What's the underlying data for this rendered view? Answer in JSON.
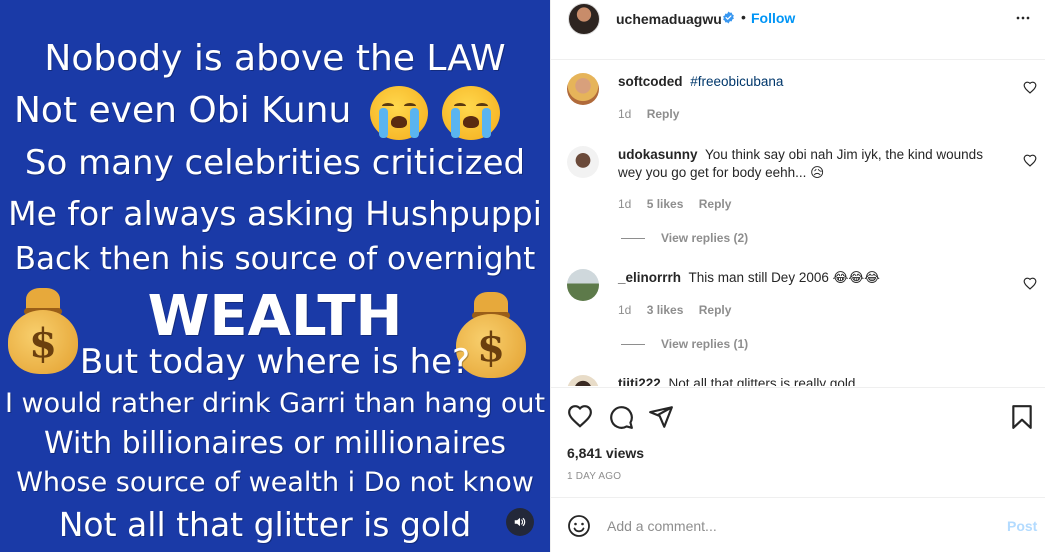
{
  "media": {
    "lines": [
      "Nobody is above the LAW",
      "Not even Obi Kunu",
      "So many celebrities criticized",
      "Me for always asking Hushpuppi",
      "Back then his source of overnight",
      "WEALTH",
      "But today where is he?",
      "I would rather drink Garri than hang out",
      "With billionaires or millionaires",
      "Whose source of wealth i Do not know",
      "Not all that glitter is gold"
    ],
    "emoji_cry": "loudly-crying-face",
    "emoji_money": "money-bag",
    "money_sign": "$",
    "background": "#1a3aa7"
  },
  "header": {
    "username": "uchemaduagwu",
    "separator": "•",
    "follow_label": "Follow"
  },
  "comments": [
    {
      "username": "softcoded",
      "text": "#freeobicubana",
      "time": "1d",
      "likes": "",
      "reply": "Reply"
    },
    {
      "username": "udokasunny",
      "text": "You think say obi nah Jim iyk, the kind wounds wey you go get for body eehh...",
      "emoji": "😥",
      "time": "1d",
      "likes": "5 likes",
      "reply": "Reply",
      "view_replies": "View replies (2)"
    },
    {
      "username": "_elinorrrh",
      "text": "This man still Dey 2006",
      "emoji": "😂😂😂",
      "time": "1d",
      "likes": "3 likes",
      "reply": "Reply",
      "view_replies": "View replies (1)"
    },
    {
      "username": "tiiti222",
      "text": "Not all that glitters is really gold"
    }
  ],
  "stats": {
    "views": "6,841 views",
    "ago": "1 DAY AGO"
  },
  "add_comment": {
    "placeholder": "Add a comment...",
    "post_label": "Post"
  },
  "colors": {
    "accent": "#0095f6",
    "post_disabled": "#b3dbff",
    "hashtag": "#00376b"
  }
}
